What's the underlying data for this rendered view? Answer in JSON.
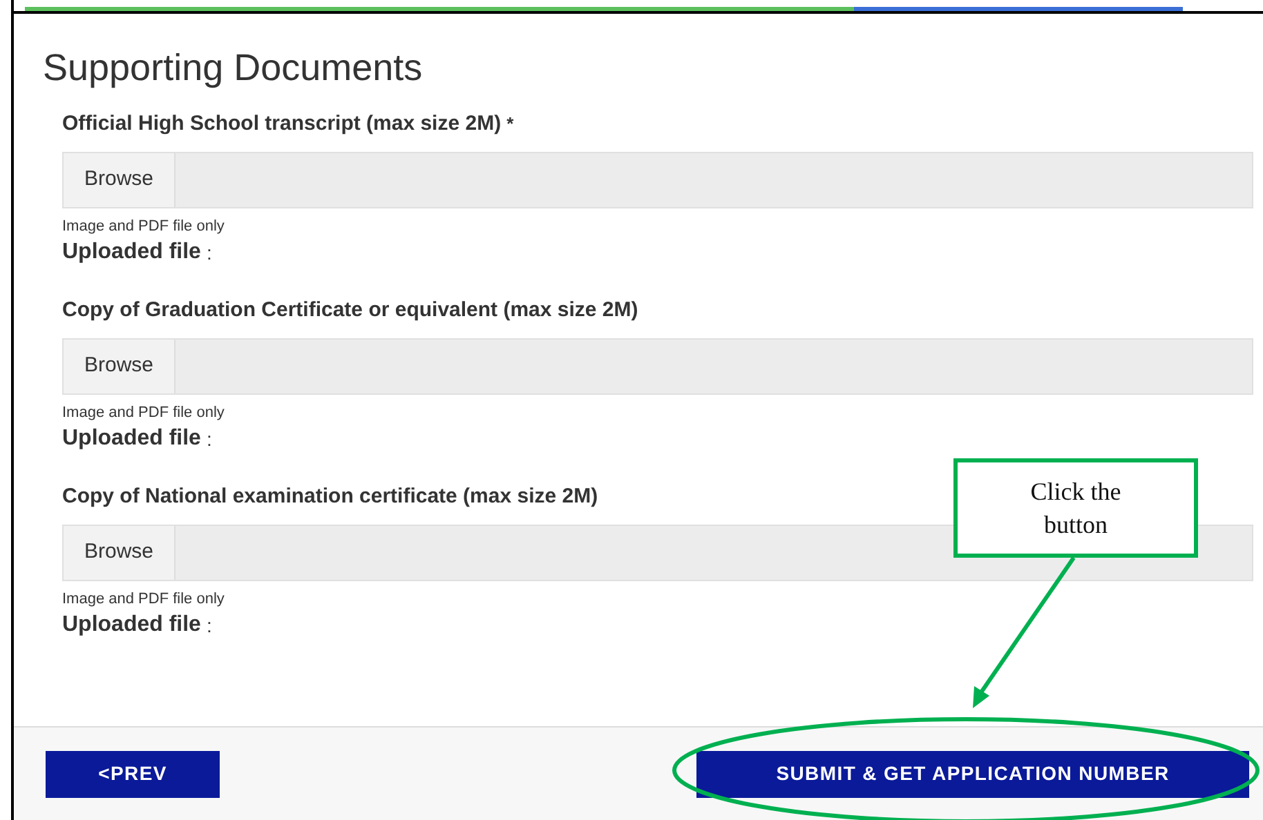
{
  "title": "Supporting Documents",
  "uploads": [
    {
      "label": "Official High School transcript (max size 2M)",
      "required": true,
      "button": "Browse",
      "hint": "Image and PDF file only",
      "uploaded_label": "Uploaded file",
      "separator": ":"
    },
    {
      "label": "Copy of Graduation Certificate or equivalent (max size 2M)",
      "required": false,
      "button": "Browse",
      "hint": "Image and PDF file only",
      "uploaded_label": "Uploaded file",
      "separator": ":"
    },
    {
      "label": "Copy of National examination certificate (max size 2M)",
      "required": false,
      "button": "Browse",
      "hint": "Image and PDF file only",
      "uploaded_label": "Uploaded file",
      "separator": ":"
    }
  ],
  "required_mark": "*",
  "footer": {
    "prev": {
      "icon": "<",
      "label": "PREV"
    },
    "submit": "SUBMIT & GET APPLICATION NUMBER"
  },
  "annotation": {
    "text": "Click the button"
  }
}
